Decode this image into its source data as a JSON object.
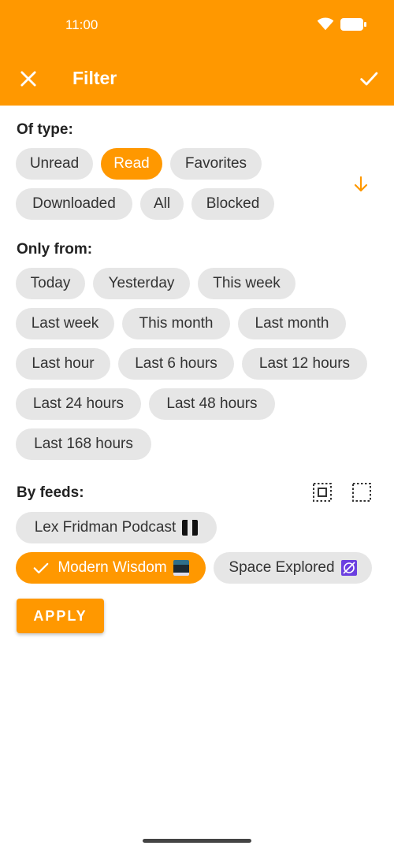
{
  "status_bar": {
    "time": "11:00"
  },
  "toolbar": {
    "title": "Filter"
  },
  "sections": {
    "type": {
      "title": "Of type:",
      "chips": [
        {
          "label": "Unread",
          "selected": false
        },
        {
          "label": "Read",
          "selected": true
        },
        {
          "label": "Favorites",
          "selected": false
        },
        {
          "label": "Downloaded",
          "selected": false
        },
        {
          "label": "All",
          "selected": false
        },
        {
          "label": "Blocked",
          "selected": false
        }
      ]
    },
    "date": {
      "title": "Only from:",
      "chips": [
        {
          "label": "Today"
        },
        {
          "label": "Yesterday"
        },
        {
          "label": "This week"
        },
        {
          "label": "Last week"
        },
        {
          "label": "This month"
        },
        {
          "label": "Last month"
        },
        {
          "label": "Last hour"
        },
        {
          "label": "Last 6 hours"
        },
        {
          "label": "Last 12 hours"
        },
        {
          "label": "Last 24 hours"
        },
        {
          "label": "Last 48 hours"
        },
        {
          "label": "Last 168 hours"
        }
      ]
    },
    "feeds": {
      "title": "By feeds:",
      "chips": [
        {
          "label": "Lex Fridman Podcast",
          "selected": false,
          "icon": "lex-fridman-thumbnail"
        },
        {
          "label": "Modern Wisdom",
          "selected": true,
          "icon": "modern-wisdom-thumbnail"
        },
        {
          "label": "Space Explored",
          "selected": false,
          "icon": "space-explored-thumbnail"
        }
      ]
    }
  },
  "apply_label": "APPLY",
  "colors": {
    "accent": "#ff9800",
    "chip_bg": "#e6e6e6",
    "chip_text": "#333333"
  }
}
